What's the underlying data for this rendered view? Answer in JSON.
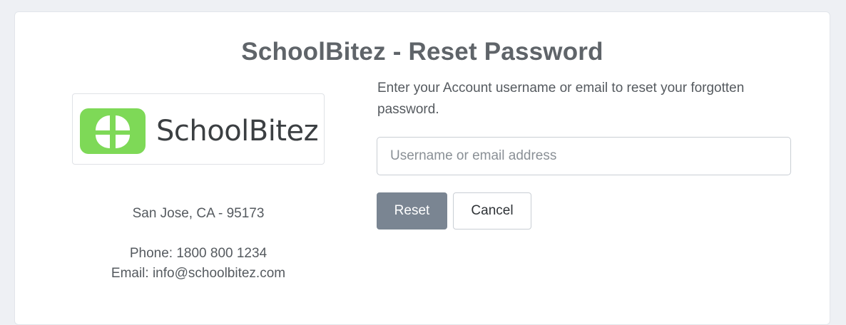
{
  "page": {
    "title": "SchoolBitez - Reset Password"
  },
  "logo": {
    "icon": "schoolbitez-logo-icon",
    "text": "SchoolBitez",
    "brand_color": "#7ed957"
  },
  "contact": {
    "address": "San Jose, CA - 95173",
    "phone": "Phone: 1800 800 1234",
    "email": "Email: info@schoolbitez.com"
  },
  "form": {
    "instructions": "Enter your Account username or email to reset your forgotten password.",
    "username_placeholder": "Username or email address",
    "username_value": "",
    "reset_label": "Reset",
    "cancel_label": "Cancel",
    "reset_color": "#7a8592"
  }
}
